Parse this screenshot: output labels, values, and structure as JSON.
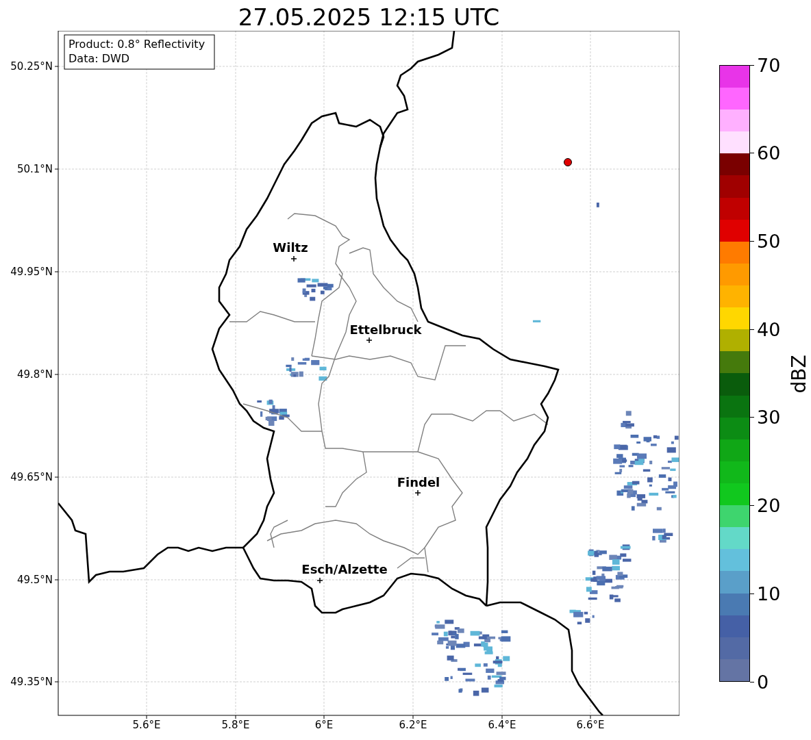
{
  "title": "27.05.2025 12:15 UTC",
  "info_box": [
    "Product: 0.8° Reflectivity",
    "Data: DWD"
  ],
  "map": {
    "x_ticks": [
      "5.6°E",
      "5.8°E",
      "6°E",
      "6.2°E",
      "6.4°E",
      "6.6°E"
    ],
    "y_ticks": [
      "50.25°N",
      "50.1°N",
      "49.95°N",
      "49.8°N",
      "49.65°N",
      "49.5°N",
      "49.35°N"
    ],
    "cities": [
      {
        "name": "Wiltz"
      },
      {
        "name": "Ettelbruck"
      },
      {
        "name": "Findel"
      },
      {
        "name": "Esch/Alzette"
      }
    ]
  },
  "colorbar": {
    "label": "dBZ",
    "ticks": [
      "70",
      "60",
      "50",
      "40",
      "30",
      "20",
      "10",
      "0"
    ],
    "segments": [
      {
        "color": "#6474a4"
      },
      {
        "color": "#536aa5"
      },
      {
        "color": "#4560a6"
      },
      {
        "color": "#4a7ab2"
      },
      {
        "color": "#5a9fc9"
      },
      {
        "color": "#63c0dc"
      },
      {
        "color": "#63d9c8"
      },
      {
        "color": "#3ed56e"
      },
      {
        "color": "#11c81e"
      },
      {
        "color": "#11b81a"
      },
      {
        "color": "#10a716"
      },
      {
        "color": "#0c8c14"
      },
      {
        "color": "#0a7410"
      },
      {
        "color": "#0a5c0c"
      },
      {
        "color": "#457a0c"
      },
      {
        "color": "#b0b000"
      },
      {
        "color": "#ffd700"
      },
      {
        "color": "#ffb300"
      },
      {
        "color": "#ff9a00"
      },
      {
        "color": "#ff7b00"
      },
      {
        "color": "#e00000"
      },
      {
        "color": "#c00000"
      },
      {
        "color": "#a00000"
      },
      {
        "color": "#7a0000"
      },
      {
        "color": "#ffe0ff"
      },
      {
        "color": "#ffb0ff"
      },
      {
        "color": "#ff66ff"
      },
      {
        "color": "#e834e8"
      }
    ]
  }
}
